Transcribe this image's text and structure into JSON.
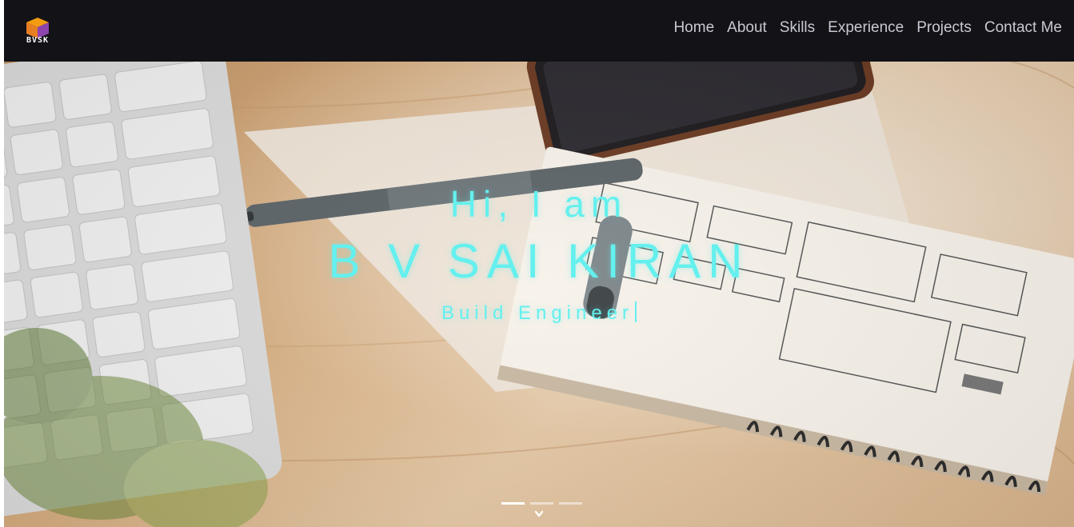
{
  "brand": {
    "logo_text": "BVSK",
    "logo_colors": {
      "top": "#f39c12",
      "left": "#e67e22",
      "right": "#8e44ad"
    }
  },
  "nav": {
    "items": [
      {
        "label": "Home"
      },
      {
        "label": "About"
      },
      {
        "label": "Skills"
      },
      {
        "label": "Experience"
      },
      {
        "label": "Projects"
      },
      {
        "label": "Contact Me"
      }
    ]
  },
  "hero": {
    "greeting": "Hi, I am",
    "name": "B V SAI KIRAN",
    "role": "Build Engineer",
    "text_color": "#63f0ee",
    "background": "desk with keyboard, phone, pen and wireframe notebook"
  },
  "carousel": {
    "slides": 3,
    "active_index": 0,
    "scroll_icon": "chevron-down-icon"
  },
  "colors": {
    "navbar_bg": "#121217",
    "nav_text": "#c9c9d2",
    "accent": "#63f0ee"
  }
}
